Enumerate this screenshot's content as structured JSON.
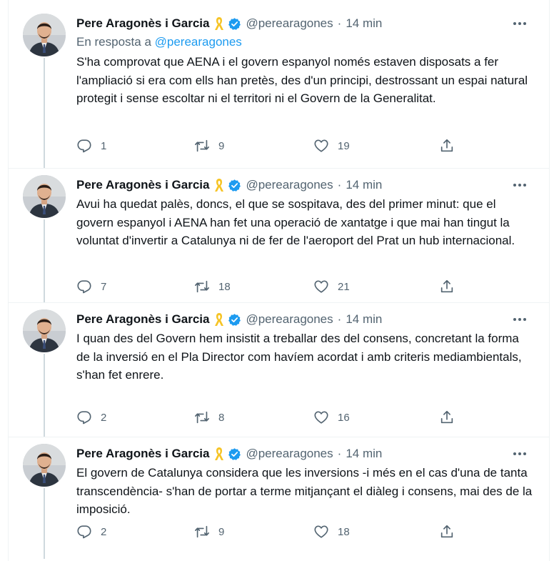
{
  "colors": {
    "link": "#1d9bf0",
    "muted": "#536471",
    "text": "#0f1419",
    "thread_line": "#cfd9de",
    "ribbon": "#f6c426"
  },
  "icons": {
    "ribbon": "yellow-ribbon-icon",
    "verified": "verified-badge-icon",
    "more": "more-options-icon",
    "reply": "reply-icon",
    "retweet": "retweet-icon",
    "like": "heart-icon",
    "share": "share-icon"
  },
  "tweets": [
    {
      "author_name": "Pere Aragonès i Garcia",
      "handle": "@perearagones",
      "separator": "·",
      "time": "14 min",
      "reply_prefix": "En resposta a",
      "reply_handle": "@perearagones",
      "text": "S'ha comprovat que AENA i el govern espanyol només estaven disposats a fer l'ampliació si era com ells han pretès, des d'un principi, destrossant un espai natural protegit i sense escoltar ni el territori ni el Govern de la Generalitat.",
      "replies": "1",
      "retweets": "9",
      "likes": "19"
    },
    {
      "author_name": "Pere Aragonès i Garcia",
      "handle": "@perearagones",
      "separator": "·",
      "time": "14 min",
      "text": "Avui ha quedat palès, doncs, el que se sospitava, des del primer minut: que el govern espanyol i AENA han fet una operació de xantatge i que mai han tingut la voluntat d'invertir a Catalunya ni de fer de l'aeroport del Prat un hub internacional.",
      "replies": "7",
      "retweets": "18",
      "likes": "21"
    },
    {
      "author_name": "Pere Aragonès i Garcia",
      "handle": "@perearagones",
      "separator": "·",
      "time": "14 min",
      "text": "I quan des del Govern hem insistit a treballar des del consens, concretant la forma de la inversió en el Pla Director com havíem acordat i amb criteris mediambientals, s'han fet enrere.",
      "replies": "2",
      "retweets": "8",
      "likes": "16"
    },
    {
      "author_name": "Pere Aragonès i Garcia",
      "handle": "@perearagones",
      "separator": "·",
      "time": "14 min",
      "text": "El govern de Catalunya considera que les inversions -i més en el cas d'una de tanta transcendència- s'han de portar a terme mitjançant el diàleg i consens, mai des de la imposició.",
      "replies": "2",
      "retweets": "9",
      "likes": "18"
    }
  ]
}
